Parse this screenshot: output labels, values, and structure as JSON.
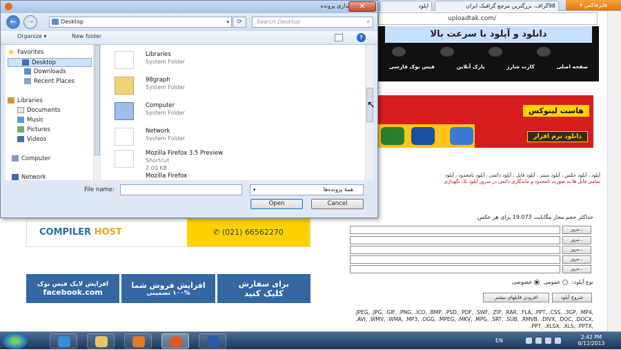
{
  "browser": {
    "tabs": [
      "98گراف، بزرگترین مرجع گرافیک ایران",
      "اپلود"
    ],
    "menu_label": "فایرفاکس",
    "url": "uploadtak.com/"
  },
  "site": {
    "slogan": "دانلود و آپلود با سرعت بالا",
    "nav": [
      "صفحه اصلی",
      "کارت شارژ",
      "پارک آنلاین",
      "فیس بوک فارسی"
    ],
    "linux_ad": {
      "title": "هاست لینوکس",
      "download": "دانلود نرم افزار"
    },
    "upload_text": "آپلود ، آپلود عکس ، آپلود سنتر ، آپلود فایل ، آپلود دائمی ، آپلود نامحدود ، آپلود",
    "upload_warning": "تمامی فایل ها به صورت نامحدود و ماندگاری دائمی در سرور آپلود تک نگهداری",
    "max_size": "حداکثر حجم مجاز مگابایت 19.073 برای هر عکس",
    "browse_label": "مرور...",
    "upload_type_label": "نوع آپلود:",
    "public_label": "عمومی",
    "private_label": "خصوصی",
    "start_upload": "شروع آپلود",
    "add_more": "افزودن فایلهای بیشتر",
    "formats": ".JPEG, .JPG, .GIF, .PNG, .ICO, .BMP, .PSD, .PDF, .SWF, .ZIP, .RAR, .FLA, .PPT, .CSS, .3GP, .MP4, .AVI, .WMV, .WMA, .MP3, .OGG, .MPEG, .MKV, .MPG, .SRT, .SUB, .RMVB, .DIVX, .DOC, .DOCX, .PPT, .XLSX, .XLS, .PPTX,"
  },
  "ads": {
    "compiler_part1": "COMPILER",
    "compiler_part2": "HOST",
    "compiler_phone": "(021) 66562270",
    "facebook": [
      "افزایش لایک فیس بوک",
      "facebook.com"
    ],
    "sales": [
      "افزایش فروش شما",
      "۱۰۰% تضمینی"
    ],
    "order": [
      "برای سفارش",
      "کلیک کنید"
    ]
  },
  "dialog": {
    "title": "بارگذاری پرونده",
    "address": "Desktop",
    "search_placeholder": "Search Desktop",
    "organize": "Organize ▾",
    "new_folder": "New folder",
    "nav": {
      "favorites": "Favorites",
      "desktop": "Desktop",
      "downloads": "Downloads",
      "recent": "Recent Places",
      "libraries": "Libraries",
      "documents": "Documents",
      "music": "Music",
      "pictures": "Pictures",
      "videos": "Videos",
      "computer": "Computer",
      "network": "Network"
    },
    "files": [
      {
        "name": "Libraries",
        "type": "System Folder",
        "size": ""
      },
      {
        "name": "98graph",
        "type": "System Folder",
        "size": ""
      },
      {
        "name": "Computer",
        "type": "System Folder",
        "size": ""
      },
      {
        "name": "Network",
        "type": "System Folder",
        "size": ""
      },
      {
        "name": "Mozilla Firefox 3.5 Preview",
        "type": "Shortcut",
        "size": "2.00 KB"
      },
      {
        "name": "Mozilla Firefox",
        "type": "",
        "size": ""
      }
    ],
    "file_name_label": "File name:",
    "filter": "همهٔ پرونده‌ها",
    "open": "Open",
    "cancel": "Cancel"
  },
  "taskbar": {
    "lang": "EN",
    "time": "2:42 PM",
    "date": "6/12/2013"
  }
}
